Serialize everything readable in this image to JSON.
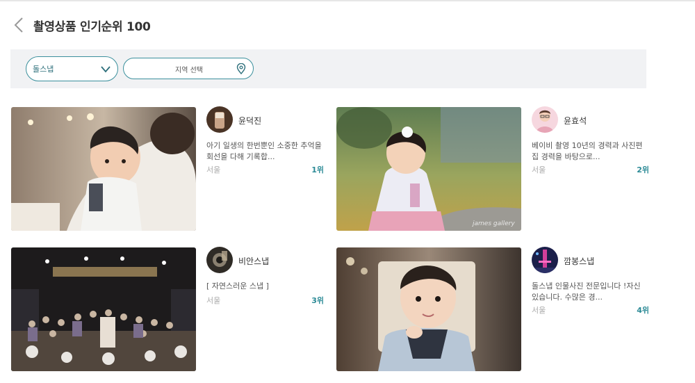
{
  "header": {
    "title": "촬영상품 인기순위 100"
  },
  "filters": {
    "category_value": "돌스냅",
    "region_placeholder": "지역 선택"
  },
  "products": [
    {
      "photographer": "윤덕진",
      "description": "아기 일생의 한번뿐인 소중한 추억을 회선을 다해 기록합...",
      "location": "서울",
      "rank": "1위"
    },
    {
      "photographer": "윤효석",
      "description": "베이비 촬영 10년의 경력과 사진편집 경력을 바탕으로...",
      "location": "서울",
      "rank": "2위"
    },
    {
      "photographer": "비안스냅",
      "description": "[ 자연스러운 스냅 ]",
      "location": "서울",
      "rank": "3위"
    },
    {
      "photographer": "깜봉스냅",
      "description": "돌스냅 인물사진 전문입니다 !자신 있습니다. 수많은 경...",
      "location": "서울",
      "rank": "4위"
    }
  ],
  "watermark": "james gallery",
  "colors": {
    "accent": "#2b8a96",
    "filter_bg": "#f1f2f4"
  },
  "icons": {
    "back": "chevron-left-icon",
    "dropdown": "chevron-down-icon",
    "region": "map-pin-icon"
  }
}
